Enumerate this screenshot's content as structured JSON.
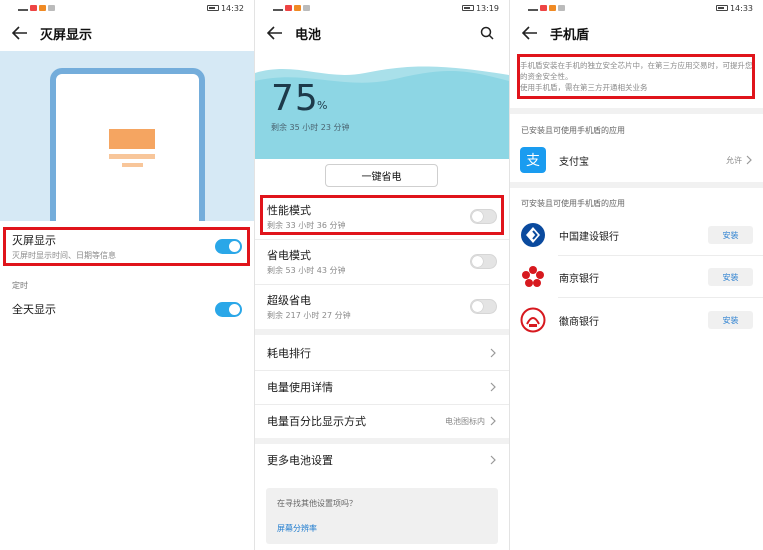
{
  "panel1": {
    "status_time": "14:32",
    "title": "灭屏显示",
    "aod_row": {
      "title": "灭屏显示",
      "subtitle": "灭屏时显示时间、日期等信息",
      "enabled": true
    },
    "schedule_label": "定时",
    "allday_row": {
      "title": "全天显示",
      "enabled": true
    }
  },
  "panel2": {
    "status_time": "13:19",
    "title": "电池",
    "battery": {
      "percent": "75",
      "percent_sign": "%",
      "remaining": "剩余 35 小时 23 分钟"
    },
    "one_click_label": "一键省电",
    "modes": [
      {
        "title": "性能模式",
        "subtitle": "剩余 33 小时 36 分钟",
        "enabled": false
      },
      {
        "title": "省电模式",
        "subtitle": "剩余 53 小时 43 分钟",
        "enabled": false
      },
      {
        "title": "超级省电",
        "subtitle": "剩余 217 小时 27 分钟",
        "enabled": false
      }
    ],
    "menu": [
      {
        "label": "耗电排行",
        "value": ""
      },
      {
        "label": "电量使用详情",
        "value": ""
      },
      {
        "label": "电量百分比显示方式",
        "value": "电池图标内"
      }
    ],
    "more_label": "更多电池设置",
    "help": {
      "question": "在寻找其他设置项吗？",
      "link": "屏幕分辨率"
    }
  },
  "panel3": {
    "status_time": "14:33",
    "title": "手机盾",
    "notice_line1": "手机盾安装在手机的独立安全芯片中，在第三方应用交易时，可提升您的资金安全性。",
    "notice_line2": "使用手机盾，需在第三方开通相关业务",
    "installed_title": "已安装且可使用手机盾的应用",
    "installed_apps": [
      {
        "name": "支付宝",
        "action": "允许"
      }
    ],
    "available_title": "可安装且可使用手机盾的应用",
    "available_apps": [
      {
        "name": "中国建设银行",
        "action": "安装"
      },
      {
        "name": "南京银行",
        "action": "安装"
      },
      {
        "name": "徽商银行",
        "action": "安装"
      }
    ]
  },
  "colors": {
    "accent_blue": "#2aa7e8",
    "highlight_red": "#e0141b",
    "aod_bg": "#d6e9f5",
    "battery_wave": "#8dd6e4"
  }
}
